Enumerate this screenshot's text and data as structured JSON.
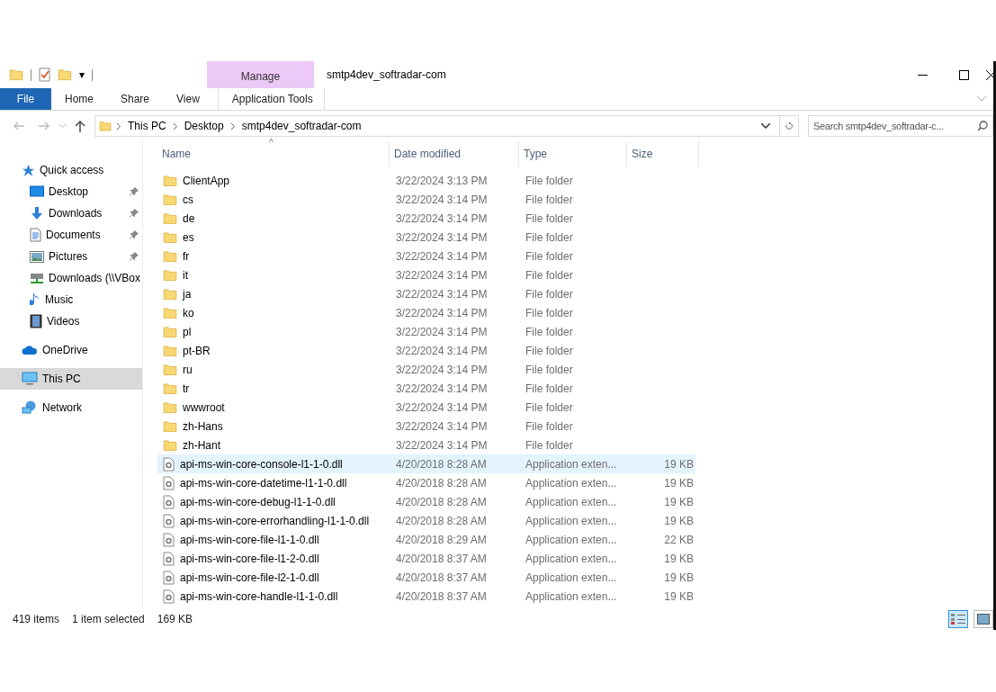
{
  "window": {
    "title": "smtp4dev_softradar-com"
  },
  "quick_access_toolbar": {
    "dropdown": "▾"
  },
  "ribbon": {
    "tabs": [
      {
        "label": "File",
        "kind": "file"
      },
      {
        "label": "Home",
        "kind": "plain"
      },
      {
        "label": "Share",
        "kind": "plain"
      },
      {
        "label": "View",
        "kind": "plain"
      },
      {
        "label": "Application Tools",
        "kind": "contextual"
      }
    ],
    "contextual_group": "Manage"
  },
  "address_bar": {
    "crumbs": [
      "This PC",
      "Desktop",
      "smtp4dev_softradar-com"
    ]
  },
  "search": {
    "placeholder": "Search smtp4dev_softradar-c..."
  },
  "sidebar": {
    "items": [
      {
        "label": "Quick access",
        "kind": "star",
        "pinned": false,
        "selected": false,
        "children": [
          {
            "label": "Desktop",
            "kind": "desktop",
            "pinned": true,
            "selected": false
          },
          {
            "label": "Downloads",
            "kind": "download",
            "pinned": true,
            "selected": false
          },
          {
            "label": "Documents",
            "kind": "document",
            "pinned": true,
            "selected": false
          },
          {
            "label": "Pictures",
            "kind": "picture",
            "pinned": true,
            "selected": false
          },
          {
            "label": "Downloads (\\\\VBox",
            "kind": "drive",
            "pinned": false,
            "selected": false
          },
          {
            "label": "Music",
            "kind": "music",
            "pinned": false,
            "selected": false
          },
          {
            "label": "Videos",
            "kind": "video",
            "pinned": false,
            "selected": false
          }
        ]
      },
      {
        "label": "OneDrive",
        "kind": "cloud",
        "pinned": false,
        "selected": false
      },
      {
        "label": "This PC",
        "kind": "pc",
        "pinned": false,
        "selected": true
      },
      {
        "label": "Network",
        "kind": "network",
        "pinned": false,
        "selected": false
      }
    ]
  },
  "table": {
    "columns": [
      "Name",
      "Date modified",
      "Type",
      "Size"
    ],
    "sort_indicator": "^",
    "rows": [
      {
        "name": "ClientApp",
        "date": "3/22/2024 3:13 PM",
        "type": "File folder",
        "size": "",
        "kind": "folder",
        "selected": false
      },
      {
        "name": "cs",
        "date": "3/22/2024 3:14 PM",
        "type": "File folder",
        "size": "",
        "kind": "folder",
        "selected": false
      },
      {
        "name": "de",
        "date": "3/22/2024 3:14 PM",
        "type": "File folder",
        "size": "",
        "kind": "folder",
        "selected": false
      },
      {
        "name": "es",
        "date": "3/22/2024 3:14 PM",
        "type": "File folder",
        "size": "",
        "kind": "folder",
        "selected": false
      },
      {
        "name": "fr",
        "date": "3/22/2024 3:14 PM",
        "type": "File folder",
        "size": "",
        "kind": "folder",
        "selected": false
      },
      {
        "name": "it",
        "date": "3/22/2024 3:14 PM",
        "type": "File folder",
        "size": "",
        "kind": "folder",
        "selected": false
      },
      {
        "name": "ja",
        "date": "3/22/2024 3:14 PM",
        "type": "File folder",
        "size": "",
        "kind": "folder",
        "selected": false
      },
      {
        "name": "ko",
        "date": "3/22/2024 3:14 PM",
        "type": "File folder",
        "size": "",
        "kind": "folder",
        "selected": false
      },
      {
        "name": "pl",
        "date": "3/22/2024 3:14 PM",
        "type": "File folder",
        "size": "",
        "kind": "folder",
        "selected": false
      },
      {
        "name": "pt-BR",
        "date": "3/22/2024 3:14 PM",
        "type": "File folder",
        "size": "",
        "kind": "folder",
        "selected": false
      },
      {
        "name": "ru",
        "date": "3/22/2024 3:14 PM",
        "type": "File folder",
        "size": "",
        "kind": "folder",
        "selected": false
      },
      {
        "name": "tr",
        "date": "3/22/2024 3:14 PM",
        "type": "File folder",
        "size": "",
        "kind": "folder",
        "selected": false
      },
      {
        "name": "wwwroot",
        "date": "3/22/2024 3:14 PM",
        "type": "File folder",
        "size": "",
        "kind": "folder",
        "selected": false
      },
      {
        "name": "zh-Hans",
        "date": "3/22/2024 3:14 PM",
        "type": "File folder",
        "size": "",
        "kind": "folder",
        "selected": false
      },
      {
        "name": "zh-Hant",
        "date": "3/22/2024 3:14 PM",
        "type": "File folder",
        "size": "",
        "kind": "folder",
        "selected": false
      },
      {
        "name": "api-ms-win-core-console-l1-1-0.dll",
        "date": "4/20/2018 8:28 AM",
        "type": "Application exten...",
        "size": "19 KB",
        "kind": "dll",
        "selected": true
      },
      {
        "name": "api-ms-win-core-datetime-l1-1-0.dll",
        "date": "4/20/2018 8:28 AM",
        "type": "Application exten...",
        "size": "19 KB",
        "kind": "dll",
        "selected": false
      },
      {
        "name": "api-ms-win-core-debug-l1-1-0.dll",
        "date": "4/20/2018 8:28 AM",
        "type": "Application exten...",
        "size": "19 KB",
        "kind": "dll",
        "selected": false
      },
      {
        "name": "api-ms-win-core-errorhandling-l1-1-0.dll",
        "date": "4/20/2018 8:28 AM",
        "type": "Application exten...",
        "size": "19 KB",
        "kind": "dll",
        "selected": false
      },
      {
        "name": "api-ms-win-core-file-l1-1-0.dll",
        "date": "4/20/2018 8:29 AM",
        "type": "Application exten...",
        "size": "22 KB",
        "kind": "dll",
        "selected": false
      },
      {
        "name": "api-ms-win-core-file-l1-2-0.dll",
        "date": "4/20/2018 8:37 AM",
        "type": "Application exten...",
        "size": "19 KB",
        "kind": "dll",
        "selected": false
      },
      {
        "name": "api-ms-win-core-file-l2-1-0.dll",
        "date": "4/20/2018 8:37 AM",
        "type": "Application exten...",
        "size": "19 KB",
        "kind": "dll",
        "selected": false
      },
      {
        "name": "api-ms-win-core-handle-l1-1-0.dll",
        "date": "4/20/2018 8:37 AM",
        "type": "Application exten...",
        "size": "19 KB",
        "kind": "dll",
        "selected": false
      }
    ]
  },
  "status_bar": {
    "count": "419 items",
    "selection": "1 item selected",
    "size": "169 KB"
  },
  "view_buttons": [
    {
      "kind": "details",
      "selected": true
    },
    {
      "kind": "large_icons",
      "selected": false
    }
  ]
}
